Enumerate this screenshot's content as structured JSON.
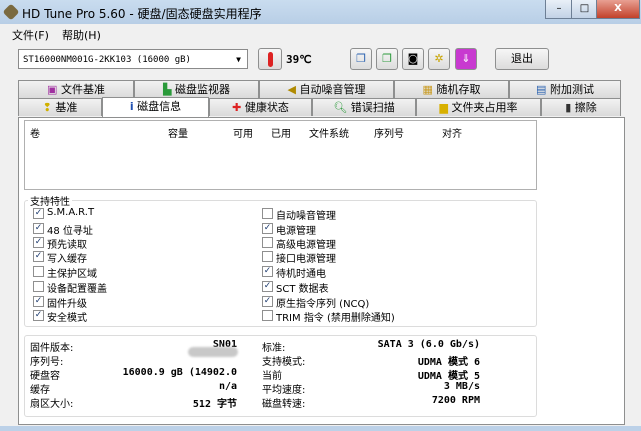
{
  "window": {
    "title": "HD Tune Pro 5.60 - 硬盘/固态硬盘实用程序",
    "minimize": "–",
    "maximize": "□",
    "close": "X"
  },
  "menu": [
    "文件(F)",
    "帮助(H)"
  ],
  "toolbar": {
    "drive": "ST16000NM001G-2KK103 (16000 gB)",
    "temperature": "39℃",
    "exit": "退出"
  },
  "tabs_row1": [
    "文件基准",
    "磁盘监视器",
    "自动噪音管理",
    "随机存取",
    "附加测试"
  ],
  "tabs_row2": [
    "基准",
    "磁盘信息",
    "健康状态",
    "错误扫描",
    "文件夹占用率",
    "擦除"
  ],
  "active_tab": "磁盘信息",
  "volumes": {
    "columns": [
      "卷",
      "容量",
      "可用",
      "已用",
      "文件系统",
      "序列号",
      "对齐"
    ]
  },
  "features": {
    "title": "支持特性",
    "left": [
      {
        "label": "S.M.A.R.T",
        "checked": true
      },
      {
        "label": "48 位寻址",
        "checked": true
      },
      {
        "label": "预先读取",
        "checked": true
      },
      {
        "label": "写入缓存",
        "checked": true
      },
      {
        "label": "主保护区域",
        "checked": false
      },
      {
        "label": "设备配置覆盖",
        "checked": false
      },
      {
        "label": "固件升级",
        "checked": true
      },
      {
        "label": "安全模式",
        "checked": true
      }
    ],
    "right": [
      {
        "label": "自动噪音管理",
        "checked": false
      },
      {
        "label": "电源管理",
        "checked": true
      },
      {
        "label": "高级电源管理",
        "checked": false
      },
      {
        "label": "接口电源管理",
        "checked": false
      },
      {
        "label": "待机时通电",
        "checked": true
      },
      {
        "label": "SCT 数据表",
        "checked": true
      },
      {
        "label": "原生指令序列 (NCQ)",
        "checked": true
      },
      {
        "label": "TRIM 指令 (禁用删除通知)",
        "checked": false
      }
    ]
  },
  "info": {
    "left": [
      {
        "label": "固件版本:",
        "value": "SN01"
      },
      {
        "label": "序列号:",
        "value": ""
      },
      {
        "label": "硬盘容",
        "value": "16000.9 gB (14902.0"
      },
      {
        "label": "缓存",
        "value": "n/a"
      },
      {
        "label": "扇区大小:",
        "value": "512 字节"
      }
    ],
    "right": [
      {
        "label": "标准:",
        "value": "SATA 3 (6.0 Gb/s)"
      },
      {
        "label": "支持模式:",
        "value": "UDMA 模式 6"
      },
      {
        "label": "当前",
        "value": "UDMA 模式 5"
      },
      {
        "label": "平均速度:",
        "value": "3 MB/s"
      },
      {
        "label": "磁盘转速:",
        "value": "7200 RPM"
      }
    ]
  }
}
